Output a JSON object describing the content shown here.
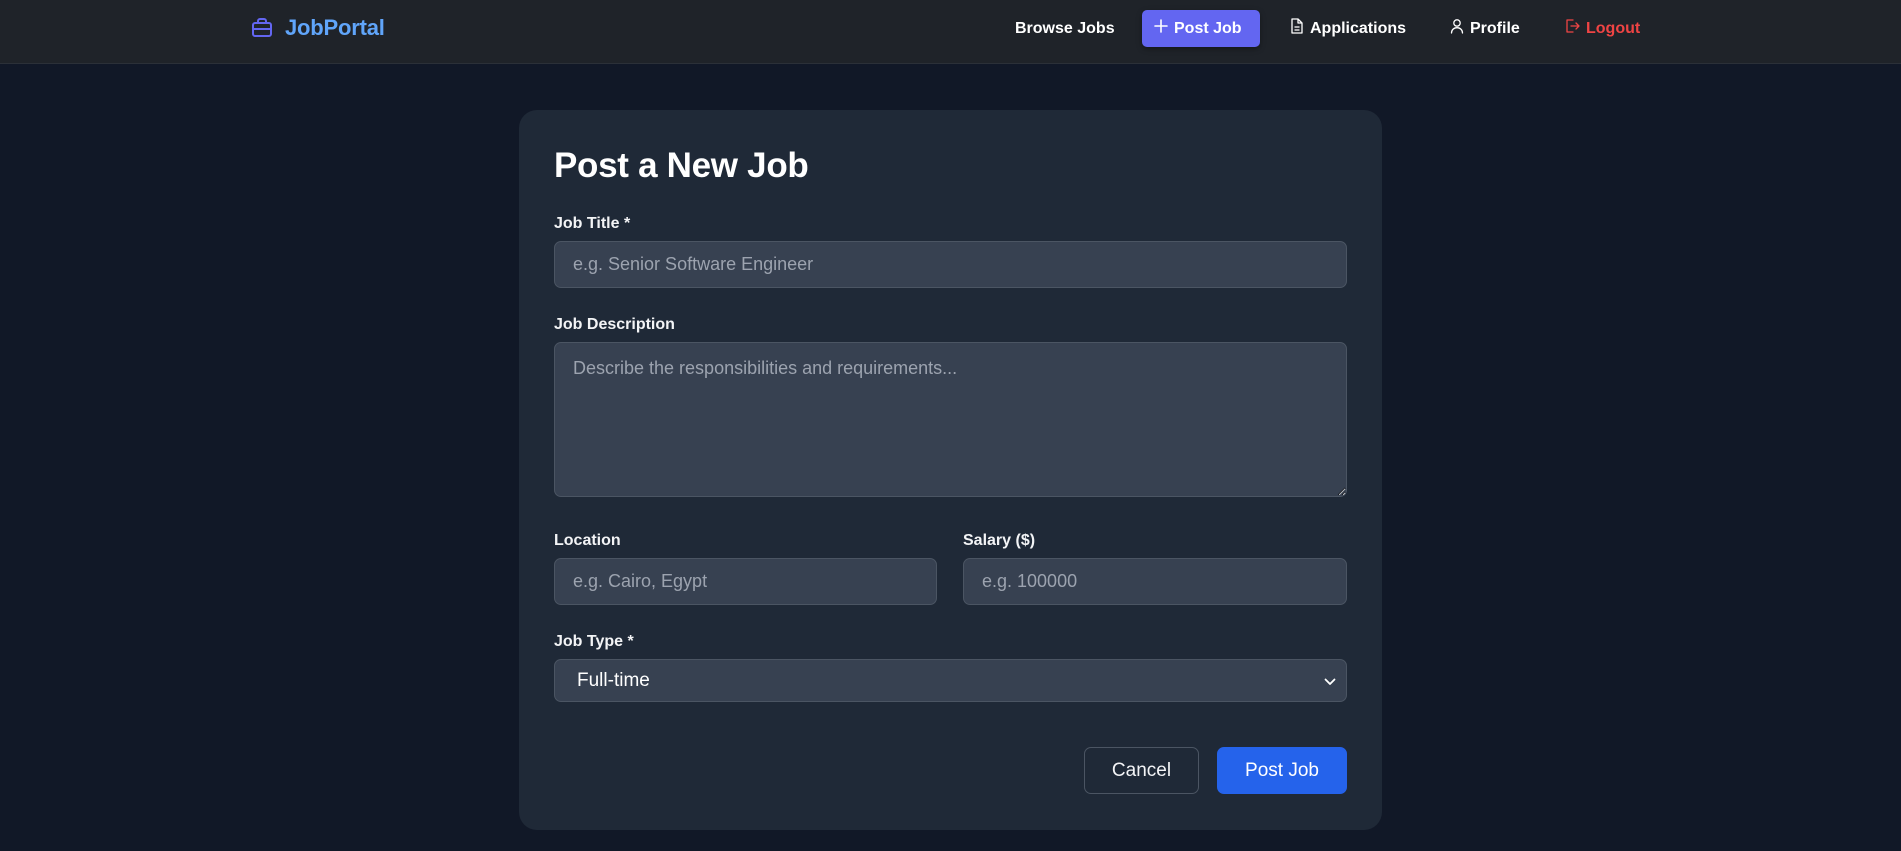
{
  "navbar": {
    "brand": {
      "name": "JobPortal",
      "icon": "briefcase-icon",
      "color": "#60a5fa"
    },
    "links": [
      {
        "label": "Browse Jobs",
        "icon": null,
        "active": false
      },
      {
        "label": "Post Job",
        "icon": "plus-icon",
        "active": true
      },
      {
        "label": "Applications",
        "icon": "document-icon",
        "active": false
      },
      {
        "label": "Profile",
        "icon": "user-icon",
        "active": false
      },
      {
        "label": "Logout",
        "icon": "logout-icon",
        "active": false,
        "color": "#ef4444"
      }
    ],
    "active_color": "#6366f1"
  },
  "form": {
    "title": "Post a New Job",
    "job_title": {
      "label": "Job Title *",
      "value": "",
      "placeholder": "e.g. Senior Software Engineer"
    },
    "job_description": {
      "label": "Job Description",
      "value": "",
      "placeholder": "Describe the responsibilities and requirements..."
    },
    "location": {
      "label": "Location",
      "value": "",
      "placeholder": "e.g. Cairo, Egypt"
    },
    "salary": {
      "label": "Salary ($)",
      "value": "",
      "placeholder": "e.g. 100000"
    },
    "job_type": {
      "label": "Job Type *",
      "selected": "Full-time"
    },
    "cancel_label": "Cancel",
    "submit_label": "Post Job",
    "submit_color": "#2563eb"
  }
}
